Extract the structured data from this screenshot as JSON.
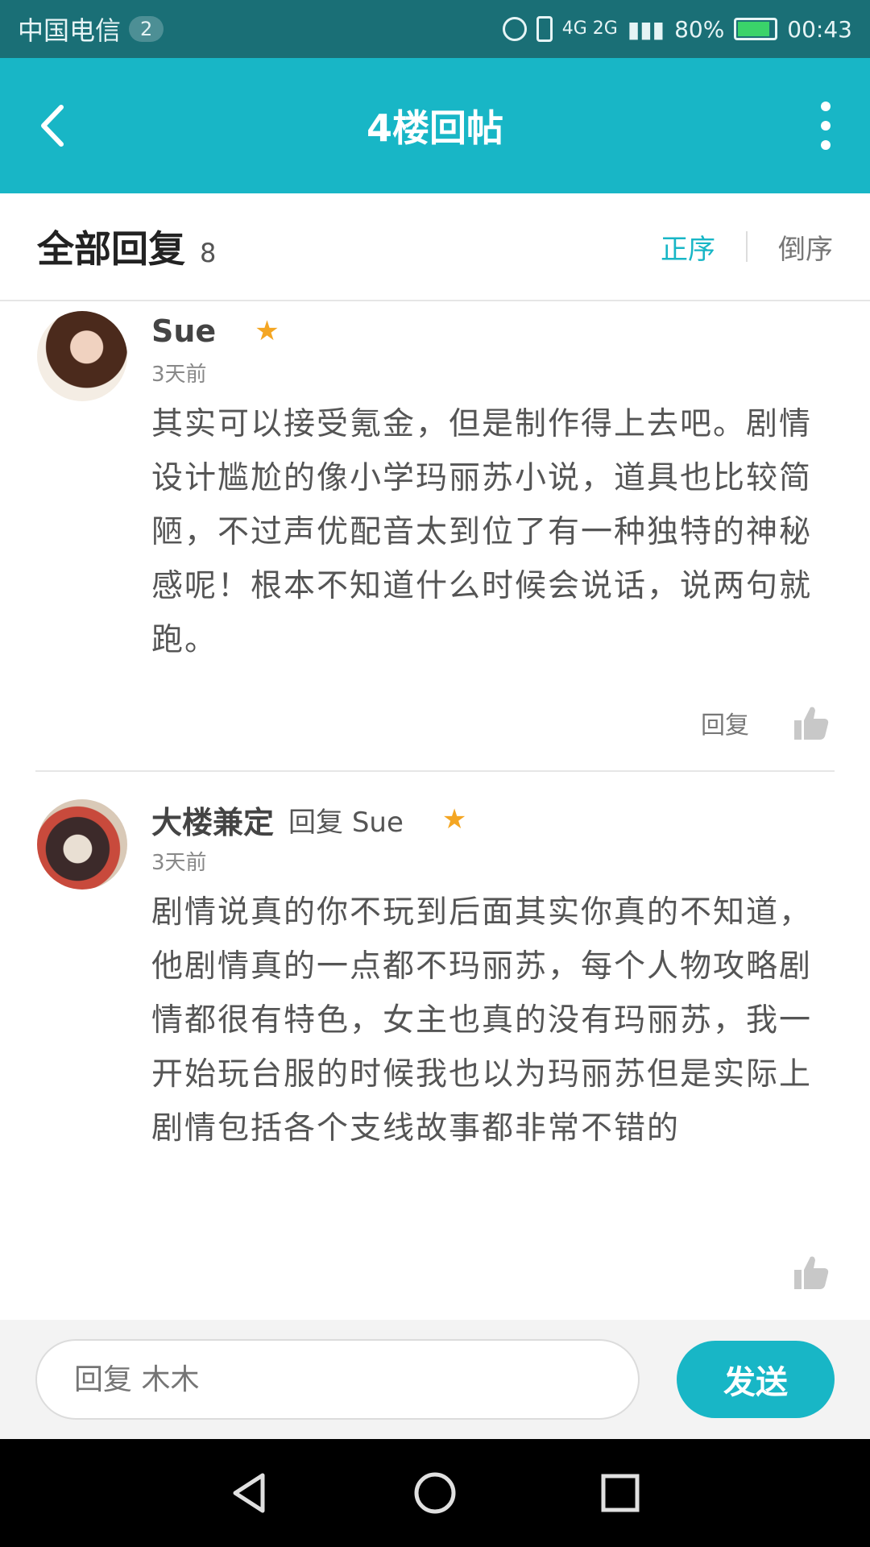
{
  "status_bar": {
    "carrier": "中国电信",
    "sim_badge": "2",
    "network": "4G 2G",
    "battery_percent": "80%",
    "time": "00:43"
  },
  "header": {
    "title": "4楼回帖"
  },
  "replies_bar": {
    "title": "全部回复",
    "count": "8",
    "sort_asc": "正序",
    "sort_desc": "倒序"
  },
  "comments": [
    {
      "user": "Sue",
      "reply_to": "",
      "time": "3天前",
      "text": "其实可以接受氪金，但是制作得上去吧。剧情设计尴尬的像小学玛丽苏小说，道具也比较简陋，不过声优配音太到位了有一种独特的神秘感呢！根本不知道什么时候会说话，说两句就跑。",
      "reply_label": "回复"
    },
    {
      "user": "大楼兼定",
      "reply_to": "回复 Sue",
      "time": "3天前",
      "text": "剧情说真的你不玩到后面其实你真的不知道，他剧情真的一点都不玛丽苏，每个人物攻略剧情都很有特色，女主也真的没有玛丽苏，我一开始玩台服的时候我也以为玛丽苏但是实际上剧情包括各个支线故事都非常不错的"
    }
  ],
  "input_bar": {
    "placeholder": "回复 木木",
    "send_label": "发送"
  },
  "colors": {
    "accent": "#18b6c6",
    "status_bar": "#1a6f76"
  }
}
